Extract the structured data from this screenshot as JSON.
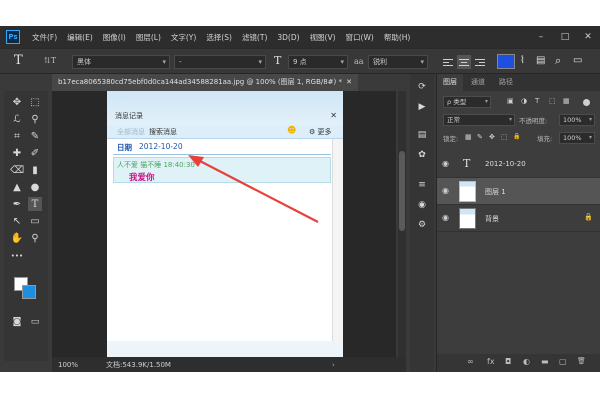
{
  "menubar": {
    "logo": "Ps",
    "items": [
      "文件(F)",
      "编辑(E)",
      "图像(I)",
      "图层(L)",
      "文字(Y)",
      "选择(S)",
      "滤镜(T)",
      "3D(D)",
      "视图(V)",
      "窗口(W)",
      "帮助(H)"
    ],
    "minimize": "–",
    "maximize": "□",
    "close": "✕"
  },
  "options": {
    "tool_glyph": "T",
    "orient_glyph": "⇅T",
    "font_family": "黑体",
    "font_style": "-",
    "size_glyph": "T",
    "font_size": "9 点",
    "aa_label": "aa",
    "aa_mode": "锐利",
    "text_color": "#1e4fe0",
    "warp_glyph": "⌇",
    "panel_glyph": "▤",
    "search_glyph": "⌕",
    "workspace_glyph": "▭"
  },
  "document": {
    "tab_title": "b17eca8065380cd75ebf0d0ca144ad34588281aa.jpg @ 100% (图层 1, RGB/8#) *",
    "close": "✕",
    "zoom": "100%",
    "doc_info": "文档:543.9K/1.50M",
    "image": {
      "window_title": "消息记录",
      "close": "✕",
      "tab_active": "全部消息",
      "tab_other": "搜索消息",
      "tool_icon": "☻",
      "more_label": "⚙ 更多",
      "date_label": "日期",
      "date_value": "2012-10-20",
      "sender_line": "人不爱 猫不睡 18:40:30",
      "message": "我爱你"
    },
    "annotation_color": "#e8403a"
  },
  "toolbar": {
    "tools": [
      "✥",
      "⬚",
      "ℒ",
      "⚲",
      "⌗",
      "✎",
      "✚",
      "✐",
      "⌫",
      "▮",
      "▲",
      "●",
      "✒",
      "T",
      "↖",
      "▭",
      "✋",
      "⚲",
      "•••"
    ],
    "fg": "#ffffff",
    "bg": "#1e8fe0"
  },
  "side_strip": {
    "icons": [
      "⟳",
      "▶",
      "▤",
      "✿",
      "≡",
      "◉",
      "⚙"
    ]
  },
  "layers_panel": {
    "tabs": [
      "图层",
      "通道",
      "路径"
    ],
    "filter_label": "ρ 类型",
    "filter_icons": [
      "▣",
      "◑",
      "T",
      "⬚",
      "▦"
    ],
    "blend_mode": "正常",
    "opacity_label": "不透明度:",
    "opacity": "100%",
    "lock_label": "锁定:",
    "lock_icons": [
      "▦",
      "✎",
      "✥",
      "⬚",
      "🔒"
    ],
    "fill_label": "填充:",
    "fill": "100%",
    "layers": [
      {
        "name": "2012-10-20",
        "type": "text",
        "selected": false
      },
      {
        "name": "图层 1",
        "type": "pixel",
        "selected": true
      },
      {
        "name": "背景",
        "type": "background",
        "selected": false,
        "locked": true
      }
    ],
    "footer_icons": [
      "∞",
      "fx",
      "◘",
      "◐",
      "▬",
      "▢",
      "🗑"
    ]
  }
}
